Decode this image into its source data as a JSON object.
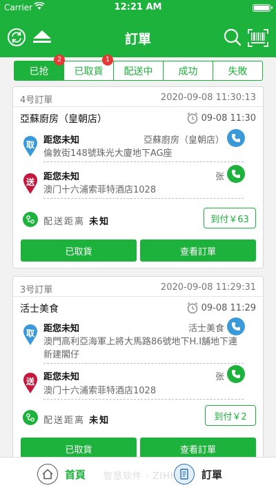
{
  "status_bar": {
    "carrier": "Carrier",
    "time": "12:21 AM"
  },
  "nav": {
    "title": "訂單"
  },
  "tabs": [
    {
      "label": "已抢",
      "badge": "2",
      "active": true
    },
    {
      "label": "已取貨",
      "badge": "1",
      "active": false
    },
    {
      "label": "配送中",
      "badge": "",
      "active": false
    },
    {
      "label": "成功",
      "badge": "",
      "active": false
    },
    {
      "label": "失敗",
      "badge": "",
      "active": false
    }
  ],
  "orders": [
    {
      "order_no": "4号訂單",
      "datetime": "2020-09-08 11:30:13",
      "shop": "亞蘇廚房（皇朝店）",
      "eta": "09-08 11:30",
      "pickup": {
        "tag": "取",
        "title": "距您未知",
        "name": "亞蘇廚房（皇朝店）",
        "address": "倫敦街148號珠光大廈地下AG座"
      },
      "dropoff": {
        "tag": "送",
        "title": "距您未知",
        "name": "张",
        "address": "澳门十六浦索菲特酒店1028"
      },
      "distance_label": "配送距离",
      "distance_value": "未知",
      "payment": "到付￥63",
      "actions": [
        "已取貨",
        "查看訂單"
      ]
    },
    {
      "order_no": "3号訂單",
      "datetime": "2020-09-08 11:29:31",
      "shop": "活士美食",
      "eta": "09-08 11:29",
      "pickup": {
        "tag": "取",
        "title": "距您未知",
        "name": "活士美食",
        "address": "澳門高利亞海軍上將大馬路86號地下H.I舖地下連新建閣仔"
      },
      "dropoff": {
        "tag": "送",
        "title": "距您未知",
        "name": "张",
        "address": "澳门十六浦索菲特酒店1028"
      },
      "distance_label": "配送距离",
      "distance_value": "未知",
      "payment": "到付￥2",
      "actions": [
        "已取貨",
        "查看訂單"
      ]
    }
  ],
  "bottom_nav": [
    {
      "label": "首頁",
      "icon": "home-icon",
      "active": false
    },
    {
      "label": "訂單",
      "icon": "document-icon",
      "active": true
    }
  ],
  "watermark": "智慧软件 · ZIHH",
  "colors": {
    "brand": "#1db23c",
    "pickup_pin": "#3a9ad9",
    "dropoff_pin": "#c4173d",
    "badge": "#e53935"
  }
}
